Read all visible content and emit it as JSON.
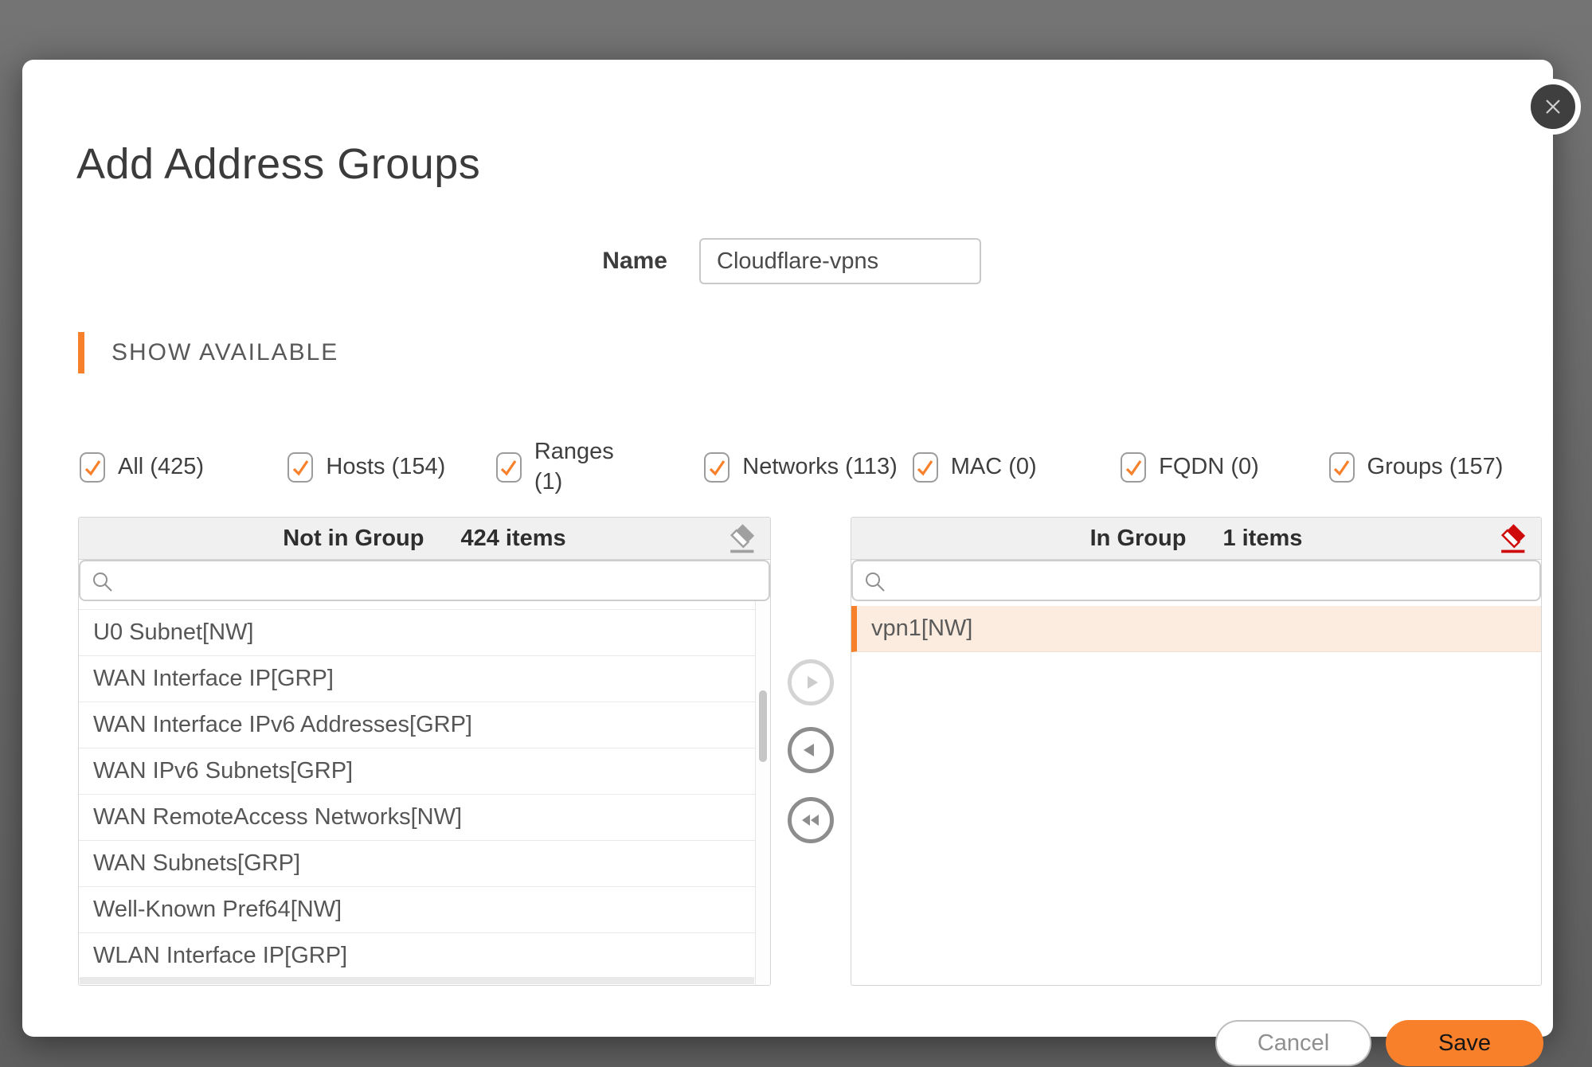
{
  "dialog": {
    "title": "Add Address Groups"
  },
  "name_field": {
    "label": "Name",
    "value": "Cloudflare-vpns"
  },
  "section_heading": "SHOW AVAILABLE",
  "filters": [
    "All (425)",
    "Hosts (154)",
    "Ranges (1)",
    "Networks (113)",
    "MAC (0)",
    "FQDN (0)",
    "Groups (157)"
  ],
  "not_in_group": {
    "title": "Not in Group",
    "count": "424 items",
    "search_value": "",
    "items": [
      "U0 Subnet[NW]",
      "WAN Interface IP[GRP]",
      "WAN Interface IPv6 Addresses[GRP]",
      "WAN IPv6 Subnets[GRP]",
      "WAN RemoteAccess Networks[NW]",
      "WAN Subnets[GRP]",
      "Well-Known Pref64[NW]",
      "WLAN Interface IP[GRP]"
    ]
  },
  "in_group": {
    "title": "In Group",
    "count": "1 items",
    "search_value": "",
    "items": [
      "vpn1[NW]"
    ]
  },
  "footer": {
    "cancel_label": "Cancel",
    "save_label": "Save"
  },
  "colors": {
    "accent_orange": "#f7802a",
    "eraser_red": "#cf0a0a",
    "backdrop_gray": "#6a6a6a"
  }
}
